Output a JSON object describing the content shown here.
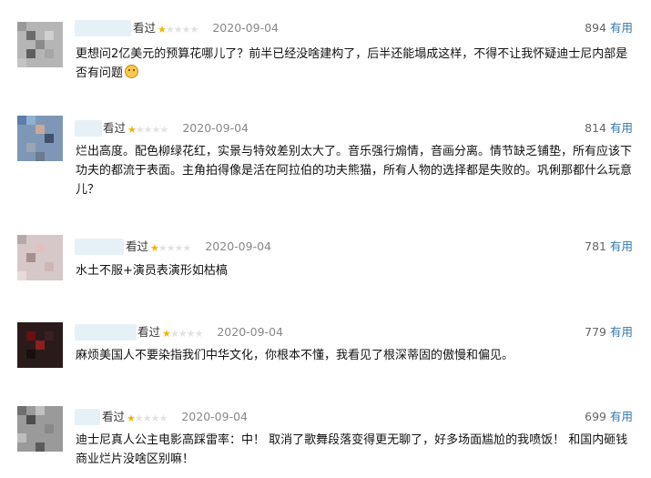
{
  "reviews": [
    {
      "status": "看过",
      "rating": 1,
      "date": "2020-09-04",
      "votes": "894",
      "useful_label": "有用",
      "text": "更想问2亿美元的预算花哪儿了？前半已经没啥建构了，后半还能塌成这样，不得不让我怀疑迪士尼内部是否有问题",
      "emoji": "sad-face"
    },
    {
      "status": "看过",
      "rating": 1,
      "date": "2020-09-04",
      "votes": "814",
      "useful_label": "有用",
      "text": "烂出高度。配色柳绿花红，实景与特效差别太大了。音乐强行煽情，音画分离。情节缺乏铺垫，所有应该下功夫的都流于表面。主角拍得像是活在阿拉伯的功夫熊猫，所有人物的选择都是失败的。巩俐那都什么玩意儿？"
    },
    {
      "status": "看过",
      "rating": 1,
      "date": "2020-09-04",
      "votes": "781",
      "useful_label": "有用",
      "text": "水土不服+演员表演形如枯槁"
    },
    {
      "status": "看过",
      "rating": 1,
      "date": "2020-09-04",
      "votes": "779",
      "useful_label": "有用",
      "text": "麻烦美国人不要染指我们中华文化，你根本不懂，我看见了根深蒂固的傲慢和偏见。"
    },
    {
      "status": "看过",
      "rating": 1,
      "date": "2020-09-04",
      "votes": "699",
      "useful_label": "有用",
      "text": "迪士尼真人公主电影高踩雷率：中！ 取消了歌舞段落变得更无聊了，好多场面尴尬的我喷饭！ 和国内砸钱商业烂片没啥区别嘛！"
    }
  ]
}
